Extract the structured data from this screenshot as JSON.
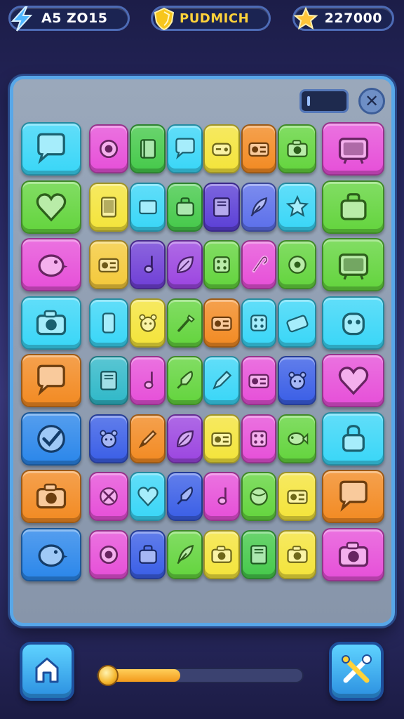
{
  "header": {
    "energy_text": "A5 ZO15",
    "title_text": "PUDMICH",
    "stars_text": "227000",
    "icons": {
      "energy": "lightning-bolt-icon",
      "title": "gem-shield-icon",
      "stars": "star-icon"
    }
  },
  "board": {
    "close_icon": "close-icon",
    "toggle_icon": "toggle-switch-icon"
  },
  "progress": {
    "value": 0.4
  },
  "buttons": {
    "home_icon": "home-icon",
    "tools_icon": "crossed-tools-icon"
  },
  "colors": {
    "board_border": "#58a7e8",
    "accent_gold": "#ffd23a",
    "slider_fill": "#f3a52a"
  },
  "grid": [
    [
      {
        "c": "#39d6f7",
        "icon": "speech-bubble-icon"
      },
      {
        "c": "#e64fd8",
        "icon": "camera-lens-icon"
      },
      {
        "c": "#45c94a",
        "icon": "notebook-icon"
      },
      {
        "c": "#39d6f7",
        "icon": "speech-bubble-icon"
      },
      {
        "c": "#f4e43a",
        "icon": "game-console-icon"
      },
      {
        "c": "#f28a22",
        "icon": "radio-icon"
      },
      {
        "c": "#63d43d",
        "icon": "camera-icon"
      },
      {
        "c": "#e64fd8",
        "icon": "tv-icon"
      }
    ],
    [
      {
        "c": "#63d43d",
        "icon": "heart-icon"
      },
      {
        "c": "#f4e43a",
        "icon": "tablet-icon"
      },
      {
        "c": "#39d6f7",
        "icon": "card-icon"
      },
      {
        "c": "#45c94a",
        "icon": "bag-icon"
      },
      {
        "c": "#5b3fd6",
        "icon": "book-icon"
      },
      {
        "c": "#5b6fea",
        "icon": "feather-icon"
      },
      {
        "c": "#39d6f7",
        "icon": "star-icon"
      },
      {
        "c": "#63d43d",
        "icon": "bag-icon"
      }
    ],
    [
      {
        "c": "#e64fd8",
        "icon": "bird-icon"
      },
      {
        "c": "#f4c93a",
        "icon": "radio-icon"
      },
      {
        "c": "#6f3fd6",
        "icon": "note-icon"
      },
      {
        "c": "#9b45e0",
        "icon": "leaf-icon"
      },
      {
        "c": "#63d43d",
        "icon": "dice-icon"
      },
      {
        "c": "#e64fd8",
        "icon": "hook-icon"
      },
      {
        "c": "#63d43d",
        "icon": "donut-icon"
      },
      {
        "c": "#63d43d",
        "icon": "tv-icon"
      }
    ],
    [
      {
        "c": "#39d6f7",
        "icon": "camera-icon"
      },
      {
        "c": "#39d6f7",
        "icon": "phone-icon"
      },
      {
        "c": "#f4e43a",
        "icon": "bear-icon"
      },
      {
        "c": "#63d43d",
        "icon": "brush-icon"
      },
      {
        "c": "#f28a22",
        "icon": "radio-icon"
      },
      {
        "c": "#39d6f7",
        "icon": "dice-icon"
      },
      {
        "c": "#39d6f7",
        "icon": "keyboard-icon"
      },
      {
        "c": "#39d6f7",
        "icon": "robot-icon"
      }
    ],
    [
      {
        "c": "#f28a22",
        "icon": "speech-bubble-icon"
      },
      {
        "c": "#2fb8c8",
        "icon": "book-icon"
      },
      {
        "c": "#e64fd8",
        "icon": "note-icon"
      },
      {
        "c": "#63d43d",
        "icon": "rocket-icon"
      },
      {
        "c": "#39d6f7",
        "icon": "pencil-icon"
      },
      {
        "c": "#e64fd8",
        "icon": "radio-icon"
      },
      {
        "c": "#3a5ee6",
        "icon": "bear-icon"
      },
      {
        "c": "#e64fd8",
        "icon": "heart-icon"
      }
    ],
    [
      {
        "c": "#2a86ea",
        "icon": "checkmark-icon"
      },
      {
        "c": "#3a5ee6",
        "icon": "bear-icon"
      },
      {
        "c": "#f28a22",
        "icon": "crayon-icon"
      },
      {
        "c": "#9b45e0",
        "icon": "leaf-icon"
      },
      {
        "c": "#f4e43a",
        "icon": "radio-icon"
      },
      {
        "c": "#e64fd8",
        "icon": "dice-icon"
      },
      {
        "c": "#63d43d",
        "icon": "fish-icon"
      },
      {
        "c": "#39d6f7",
        "icon": "lock-icon"
      }
    ],
    [
      {
        "c": "#f28a22",
        "icon": "camera-icon"
      },
      {
        "c": "#e64fd8",
        "icon": "no-entry-icon"
      },
      {
        "c": "#39d6f7",
        "icon": "heart-icon"
      },
      {
        "c": "#3a5ee6",
        "icon": "rocket-icon"
      },
      {
        "c": "#e64fd8",
        "icon": "note-icon"
      },
      {
        "c": "#63d43d",
        "icon": "ball-icon"
      },
      {
        "c": "#f4e43a",
        "icon": "radio-icon"
      },
      {
        "c": "#f28a22",
        "icon": "speech-bubble-icon"
      }
    ],
    [
      {
        "c": "#2a86ea",
        "icon": "bird-icon"
      },
      {
        "c": "#e64fd8",
        "icon": "camera-lens-icon"
      },
      {
        "c": "#3a5ee6",
        "icon": "bag-icon"
      },
      {
        "c": "#63d43d",
        "icon": "feather-icon"
      },
      {
        "c": "#f4e43a",
        "icon": "camera-icon"
      },
      {
        "c": "#45c94a",
        "icon": "book-icon"
      },
      {
        "c": "#f4e43a",
        "icon": "camera-icon"
      },
      {
        "c": "#e64fd8",
        "icon": "camera-icon"
      }
    ]
  ]
}
